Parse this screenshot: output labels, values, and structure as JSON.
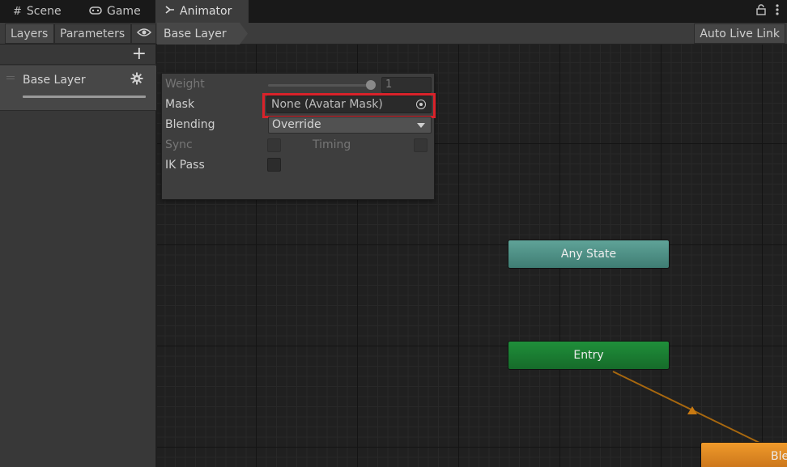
{
  "tabs": [
    {
      "label": "Scene",
      "icon": "hash-icon"
    },
    {
      "label": "Game",
      "icon": "gamepad-icon"
    },
    {
      "label": "Animator",
      "icon": "animator-icon",
      "active": true
    }
  ],
  "toolbar": {
    "layers_label": "Layers",
    "parameters_label": "Parameters",
    "breadcrumb": "Base Layer",
    "auto_live_link": "Auto Live Link"
  },
  "layers": {
    "items": [
      {
        "name": "Base Layer"
      }
    ]
  },
  "layer_settings": {
    "weight_label": "Weight",
    "weight_value": "1",
    "mask_label": "Mask",
    "mask_value": "None (Avatar Mask)",
    "blending_label": "Blending",
    "blending_value": "Override",
    "sync_label": "Sync",
    "timing_label": "Timing",
    "ik_pass_label": "IK Pass"
  },
  "graph": {
    "states": {
      "any_state": "Any State",
      "entry": "Entry",
      "blend_tree": "Ble"
    }
  },
  "colors": {
    "highlight": "#d9222a",
    "any_state": "#4f9388",
    "entry": "#1b7d33",
    "default_state": "#e08422",
    "transition": "#c97a12"
  }
}
